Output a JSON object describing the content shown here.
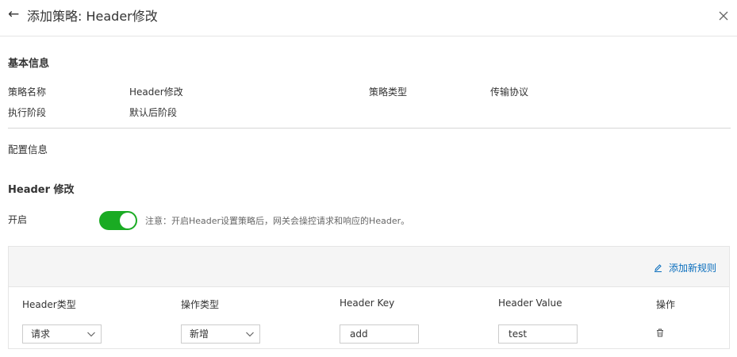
{
  "header": {
    "title": "添加策略: Header修改"
  },
  "basic": {
    "section_title": "基本信息",
    "fields": [
      {
        "label": "策略名称",
        "value": "Header修改"
      },
      {
        "label": "策略类型",
        "value": "传输协议"
      },
      {
        "label": "执行阶段",
        "value": "默认后阶段"
      }
    ]
  },
  "config": {
    "section_title": "配置信息",
    "sub_title": "Header 修改",
    "enable_label": "开启",
    "enabled": true,
    "note": "注意：开启Header设置策略后，网关会操控请求和响应的Header。",
    "add_rule": "添加新规则",
    "columns": [
      "Header类型",
      "操作类型",
      "Header Key",
      "Header Value",
      "操作"
    ],
    "row": {
      "header_type": "请求",
      "op_type": "新增",
      "key": "add",
      "value": "test"
    }
  },
  "colors": {
    "accent": "#0a6ebd",
    "toggle_on": "#1aab23"
  }
}
